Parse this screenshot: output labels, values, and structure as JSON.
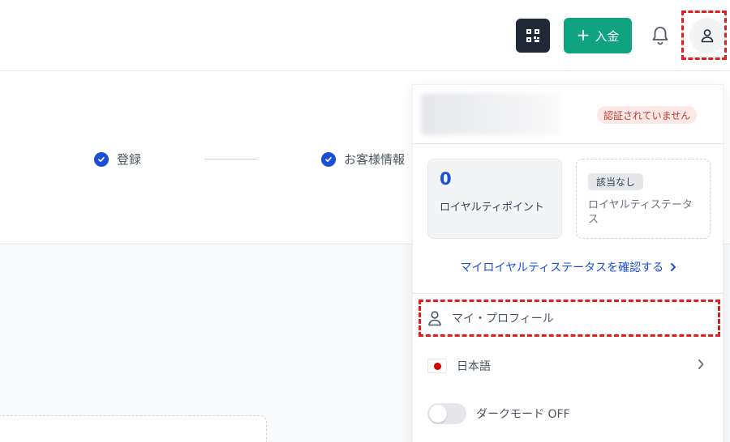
{
  "header": {
    "qr_icon": "qr-code-icon",
    "deposit_label": "入金",
    "deposit_color": "#10a37f",
    "bell_icon": "bell-icon",
    "avatar_icon": "user-icon"
  },
  "steps": [
    {
      "label": "登録",
      "status": "complete"
    },
    {
      "label": "お客様情報",
      "status": "complete"
    }
  ],
  "account_menu": {
    "verification_badge": "認証されていません",
    "loyalty_points": {
      "value": "0",
      "label": "ロイヤルティポイント"
    },
    "loyalty_status": {
      "value": "該当なし",
      "label": "ロイヤルティステータス"
    },
    "loyalty_link": "マイロイヤルティステータスを確認する",
    "items": {
      "profile": "マイ・プロフィール",
      "language": "日本語",
      "dark_mode": "ダークモード OFF"
    }
  },
  "colors": {
    "accent_blue": "#1d4ed8",
    "highlight_red": "#e11d1d"
  }
}
